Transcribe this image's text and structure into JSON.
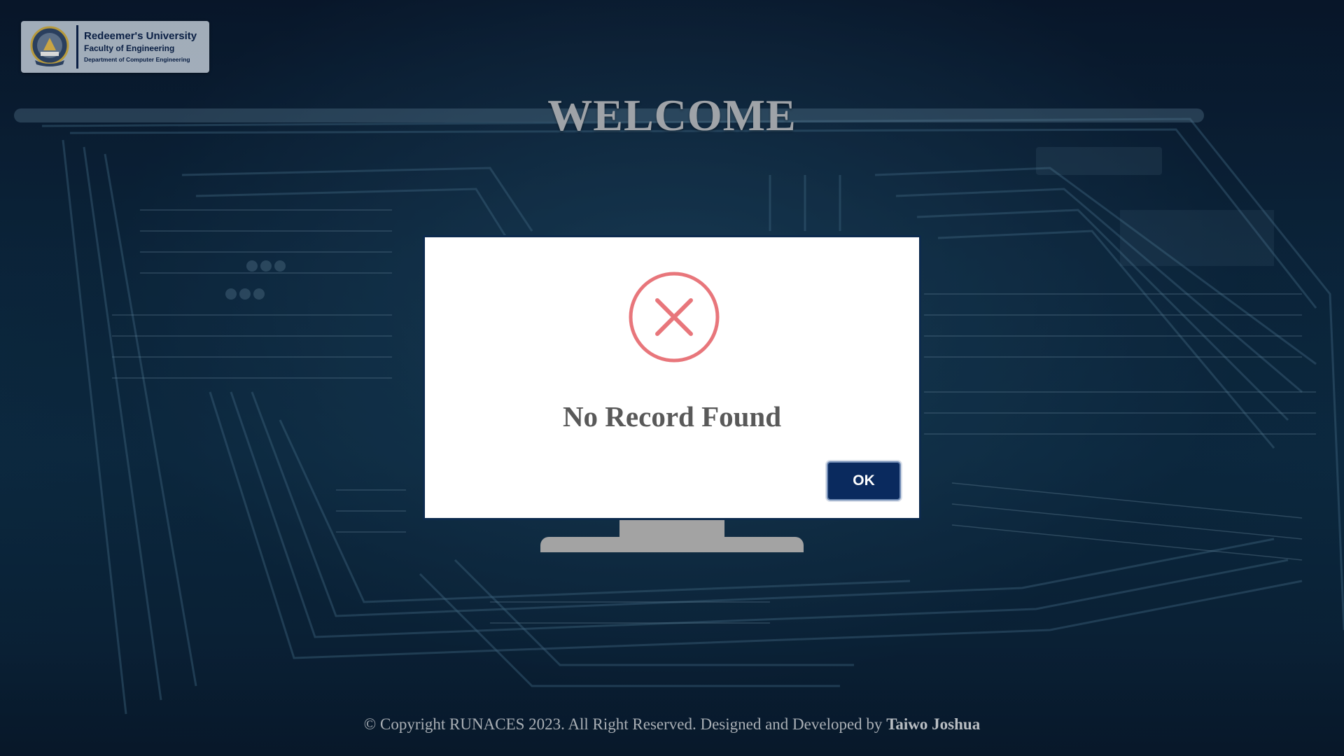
{
  "header": {
    "logo": {
      "university": "Redeemer's University",
      "faculty": "Faculty of Engineering",
      "department": "Department of Computer Engineering"
    },
    "title": "WELCOME"
  },
  "dialog": {
    "icon": "error-x-icon",
    "message": "No Record Found",
    "ok_label": "OK",
    "icon_color": "#e8767b",
    "button_color": "#0a2a5e"
  },
  "footer": {
    "copyright": "© Copyright RUNACES 2023. All Right Reserved. Designed and Developed by",
    "author": "Taiwo Joshua"
  }
}
